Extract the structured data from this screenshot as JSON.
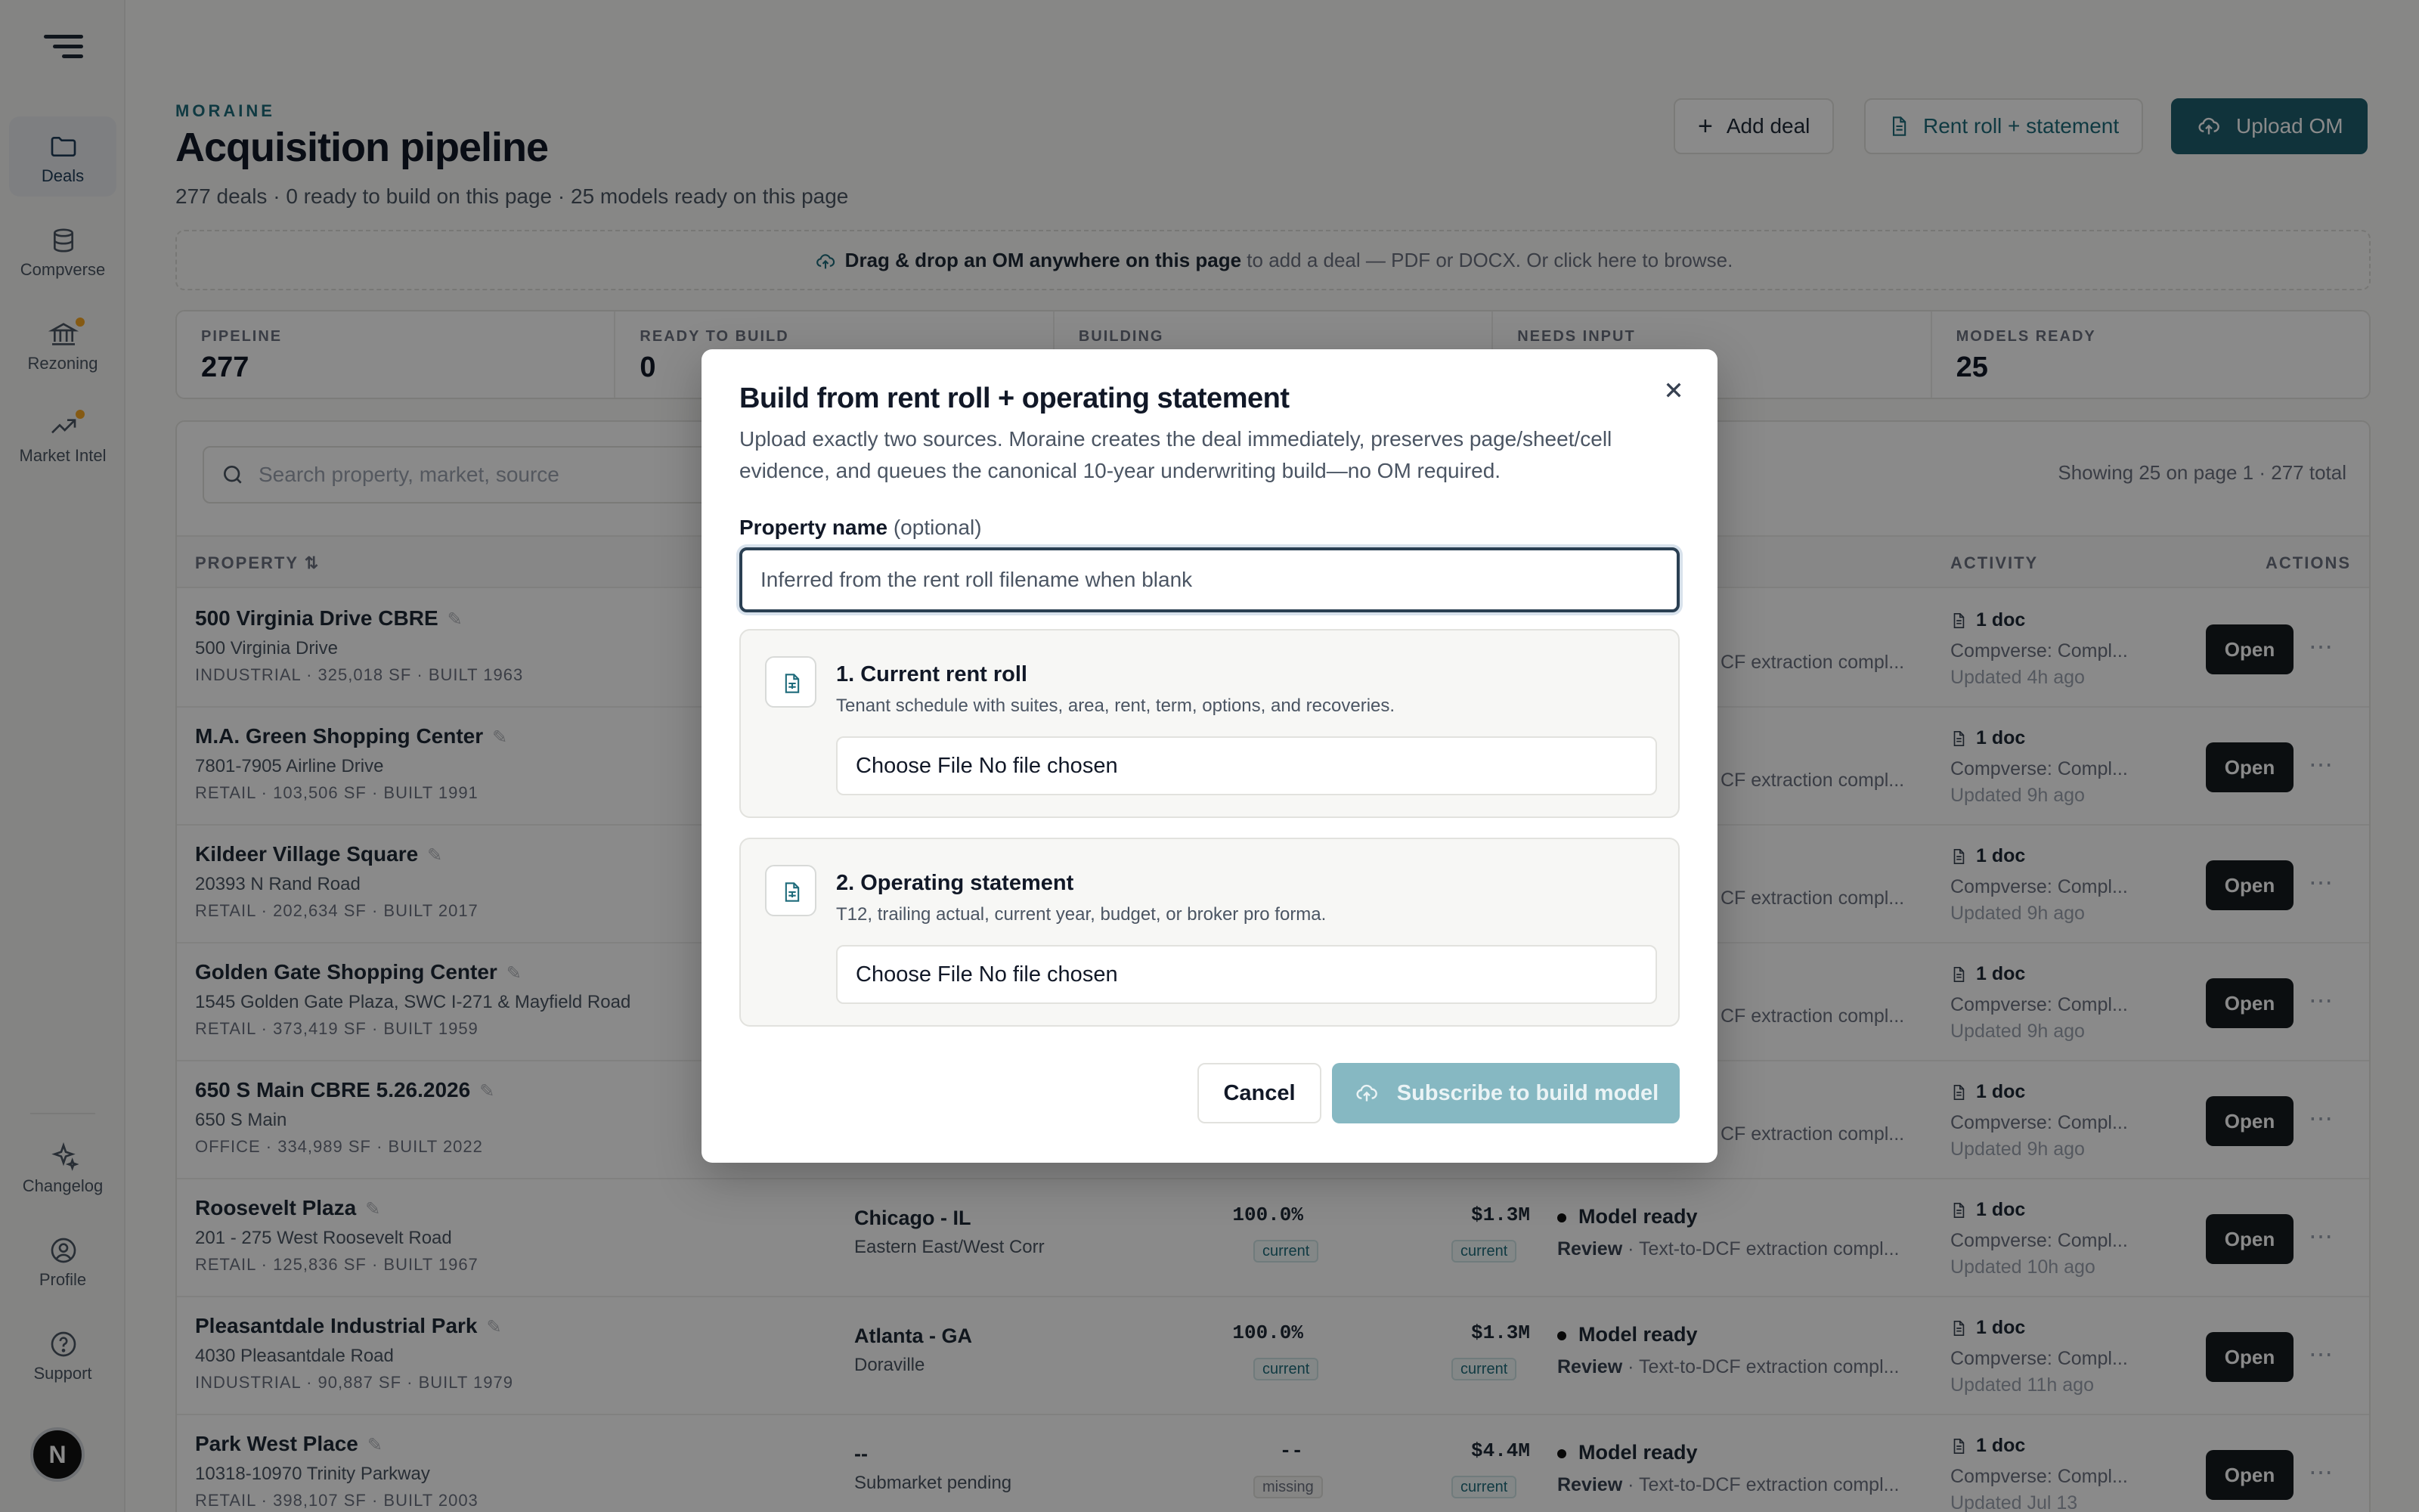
{
  "sidebar": {
    "items": [
      {
        "label": "Deals"
      },
      {
        "label": "Compverse"
      },
      {
        "label": "Rezoning"
      },
      {
        "label": "Market Intel"
      },
      {
        "label": "Changelog"
      },
      {
        "label": "Profile"
      },
      {
        "label": "Support"
      }
    ],
    "avatar": "N"
  },
  "header": {
    "eyebrow": "MORAINE",
    "title": "Acquisition pipeline",
    "subtitle": "277 deals · 0 ready to build on this page · 25 models ready on this page",
    "add_deal": "Add deal",
    "rent_roll": "Rent roll + statement",
    "upload_om": "Upload OM"
  },
  "dropzone": {
    "bold": "Drag & drop an OM anywhere on this page",
    "rest": " to add a deal — PDF or DOCX. Or click here to browse."
  },
  "stats": [
    {
      "label": "PIPELINE",
      "value": "277"
    },
    {
      "label": "READY TO BUILD",
      "value": "0"
    },
    {
      "label": "BUILDING",
      "value": ""
    },
    {
      "label": "NEEDS INPUT",
      "value": ""
    },
    {
      "label": "MODELS READY",
      "value": "25"
    }
  ],
  "table": {
    "search_placeholder": "Search property, market, source",
    "showing": "Showing 25 on page 1 · 277 total",
    "headers": {
      "property": "PROPERTY ⇅",
      "activity": "ACTIVITY",
      "actions": "ACTIONS"
    },
    "open_label": "Open",
    "rows": [
      {
        "name": "500 Virginia Drive CBRE",
        "address": "500 Virginia Drive",
        "meta": "INDUSTRIAL · 325,018 SF · BUILT 1963",
        "market": "",
        "submarket": "",
        "occ": "",
        "occ_tag": "",
        "rent": "",
        "rent_tag": "",
        "status": "",
        "review": "",
        "extraction": "CF extraction compl...",
        "docs": "1 doc",
        "source": "Compverse: Compl...",
        "updated": "Updated 4h ago"
      },
      {
        "name": "M.A. Green Shopping Center",
        "address": "7801-7905 Airline Drive",
        "meta": "RETAIL · 103,506 SF · BUILT 1991",
        "market": "",
        "submarket": "",
        "occ": "",
        "occ_tag": "",
        "rent": "",
        "rent_tag": "",
        "status": "",
        "review": "",
        "extraction": "CF extraction compl...",
        "docs": "1 doc",
        "source": "Compverse: Compl...",
        "updated": "Updated 9h ago"
      },
      {
        "name": "Kildeer Village Square",
        "address": "20393 N Rand Road",
        "meta": "RETAIL · 202,634 SF · BUILT 2017",
        "market": "",
        "submarket": "",
        "occ": "",
        "occ_tag": "",
        "rent": "",
        "rent_tag": "",
        "status": "",
        "review": "",
        "extraction": "CF extraction compl...",
        "docs": "1 doc",
        "source": "Compverse: Compl...",
        "updated": "Updated 9h ago"
      },
      {
        "name": "Golden Gate Shopping Center",
        "address": "1545 Golden Gate Plaza, SWC I-271 & Mayfield Road",
        "meta": "RETAIL · 373,419 SF · BUILT 1959",
        "market": "",
        "submarket": "",
        "occ": "",
        "occ_tag": "",
        "rent": "",
        "rent_tag": "",
        "status": "",
        "review": "",
        "extraction": "CF extraction compl...",
        "docs": "1 doc",
        "source": "Compverse: Compl...",
        "updated": "Updated 9h ago"
      },
      {
        "name": "650 S Main CBRE 5.26.2026",
        "address": "650 S Main",
        "meta": "OFFICE · 334,989 SF · BUILT 2022",
        "market": "",
        "submarket": "",
        "occ": "",
        "occ_tag": "",
        "rent": "",
        "rent_tag": "",
        "status": "",
        "review": "",
        "extraction": "CF extraction compl...",
        "docs": "1 doc",
        "source": "Compverse: Compl...",
        "updated": "Updated 9h ago"
      },
      {
        "name": "Roosevelt Plaza",
        "address": "201 - 275 West Roosevelt Road",
        "meta": "RETAIL · 125,836 SF · BUILT 1967",
        "market": "Chicago - IL",
        "submarket": "Eastern East/West Corr",
        "occ": "100.0%",
        "occ_tag": "current",
        "rent": "$1.3M",
        "rent_tag": "current",
        "status": "Model ready",
        "review": "Review",
        "extraction": "· Text-to-DCF extraction compl...",
        "docs": "1 doc",
        "source": "Compverse: Compl...",
        "updated": "Updated 10h ago"
      },
      {
        "name": "Pleasantdale Industrial Park",
        "address": "4030 Pleasantdale Road",
        "meta": "INDUSTRIAL · 90,887 SF · BUILT 1979",
        "market": "Atlanta - GA",
        "submarket": "Doraville",
        "occ": "100.0%",
        "occ_tag": "current",
        "rent": "$1.3M",
        "rent_tag": "current",
        "status": "Model ready",
        "review": "Review",
        "extraction": "· Text-to-DCF extraction compl...",
        "docs": "1 doc",
        "source": "Compverse: Compl...",
        "updated": "Updated 11h ago"
      },
      {
        "name": "Park West Place",
        "address": "10318-10970 Trinity Parkway",
        "meta": "RETAIL · 398,107 SF · BUILT 2003",
        "market": "--",
        "submarket": "Submarket pending",
        "occ": "--",
        "occ_tag": "missing",
        "rent": "$4.4M",
        "rent_tag": "current",
        "status": "Model ready",
        "review": "Review",
        "extraction": "· Text-to-DCF extraction compl...",
        "docs": "1 doc",
        "source": "Compverse: Compl...",
        "updated": "Updated Jul 13"
      }
    ]
  },
  "modal": {
    "title": "Build from rent roll + operating statement",
    "description": "Upload exactly two sources. Moraine creates the deal immediately, preserves page/sheet/cell evidence, and queues the canonical 10-year underwriting build—no OM required.",
    "field_label": "Property name",
    "field_optional": "(optional)",
    "field_placeholder": "Inferred from the rent roll filename when blank",
    "cards": [
      {
        "title": "1. Current rent roll",
        "subtitle": "Tenant schedule with suites, area, rent, term, options, and recoveries.",
        "file_text": "Choose File No file chosen"
      },
      {
        "title": "2. Operating statement",
        "subtitle": "T12, trailing actual, current year, budget, or broker pro forma.",
        "file_text": "Choose File No file chosen"
      }
    ],
    "cancel": "Cancel",
    "submit": "Subscribe to build model"
  },
  "colors": {
    "accent": "#1e5f6e",
    "submit_disabled": "#86b8c2",
    "nav_dot": "#f5a623"
  }
}
